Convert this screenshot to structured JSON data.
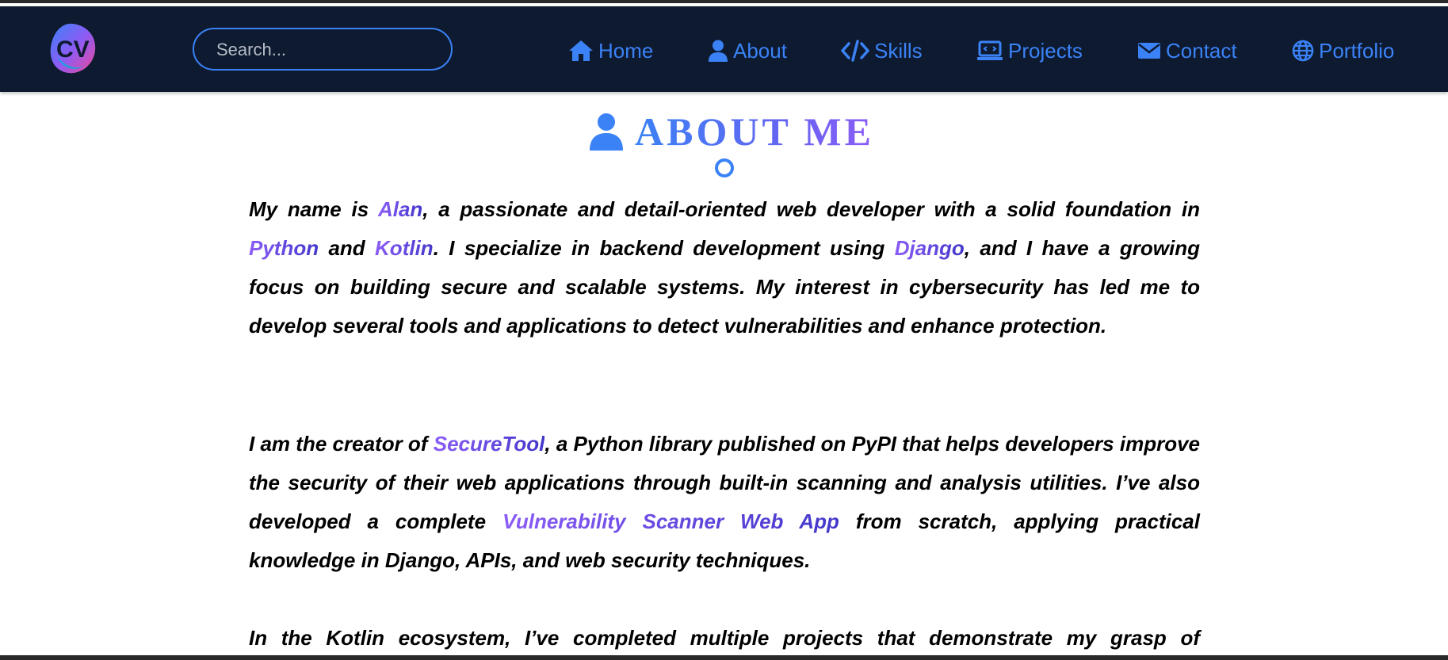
{
  "nav": {
    "logo_text": "CV",
    "search_placeholder": "Search...",
    "links": [
      {
        "label": "Home",
        "icon": "home-icon"
      },
      {
        "label": "About",
        "icon": "user-icon"
      },
      {
        "label": "Skills",
        "icon": "code-icon"
      },
      {
        "label": "Projects",
        "icon": "laptop-code-icon"
      },
      {
        "label": "Contact",
        "icon": "envelope-icon"
      },
      {
        "label": "Portfolio",
        "icon": "globe-icon"
      }
    ]
  },
  "about": {
    "title": "ABOUT ME",
    "p1": {
      "t1": "My name is ",
      "name": "Alan",
      "t2": ", a passionate and detail-oriented web developer with a solid foundation in ",
      "lang1": "Python",
      "t3": " and ",
      "lang2": "Kotlin",
      "t4": ". I specialize in backend development using ",
      "framework": "Django",
      "t5": ", and I have a growing focus on building secure and scalable systems. My interest in cybersecurity has led me to develop several tools and applications to detect vulnerabilities and enhance protection."
    },
    "p2": {
      "t1": "I am the creator of ",
      "tool": "SecureTool",
      "t2": ", a Python library published on PyPI that helps developers improve the security of their web applications through built-in scanning and analysis utilities. I’ve also developed a complete ",
      "app": "Vulnerability Scanner Web App",
      "t3": " from scratch, applying practical knowledge in Django, APIs, and web security techniques."
    },
    "p3": {
      "t1": "In the Kotlin ecosystem, I’ve completed multiple projects that demonstrate my grasp of"
    }
  },
  "colors": {
    "nav_bg": "#0d1a30",
    "accent": "#3b82f6",
    "purple": "#8b5cf6",
    "highlight_end": "#4338ca"
  }
}
